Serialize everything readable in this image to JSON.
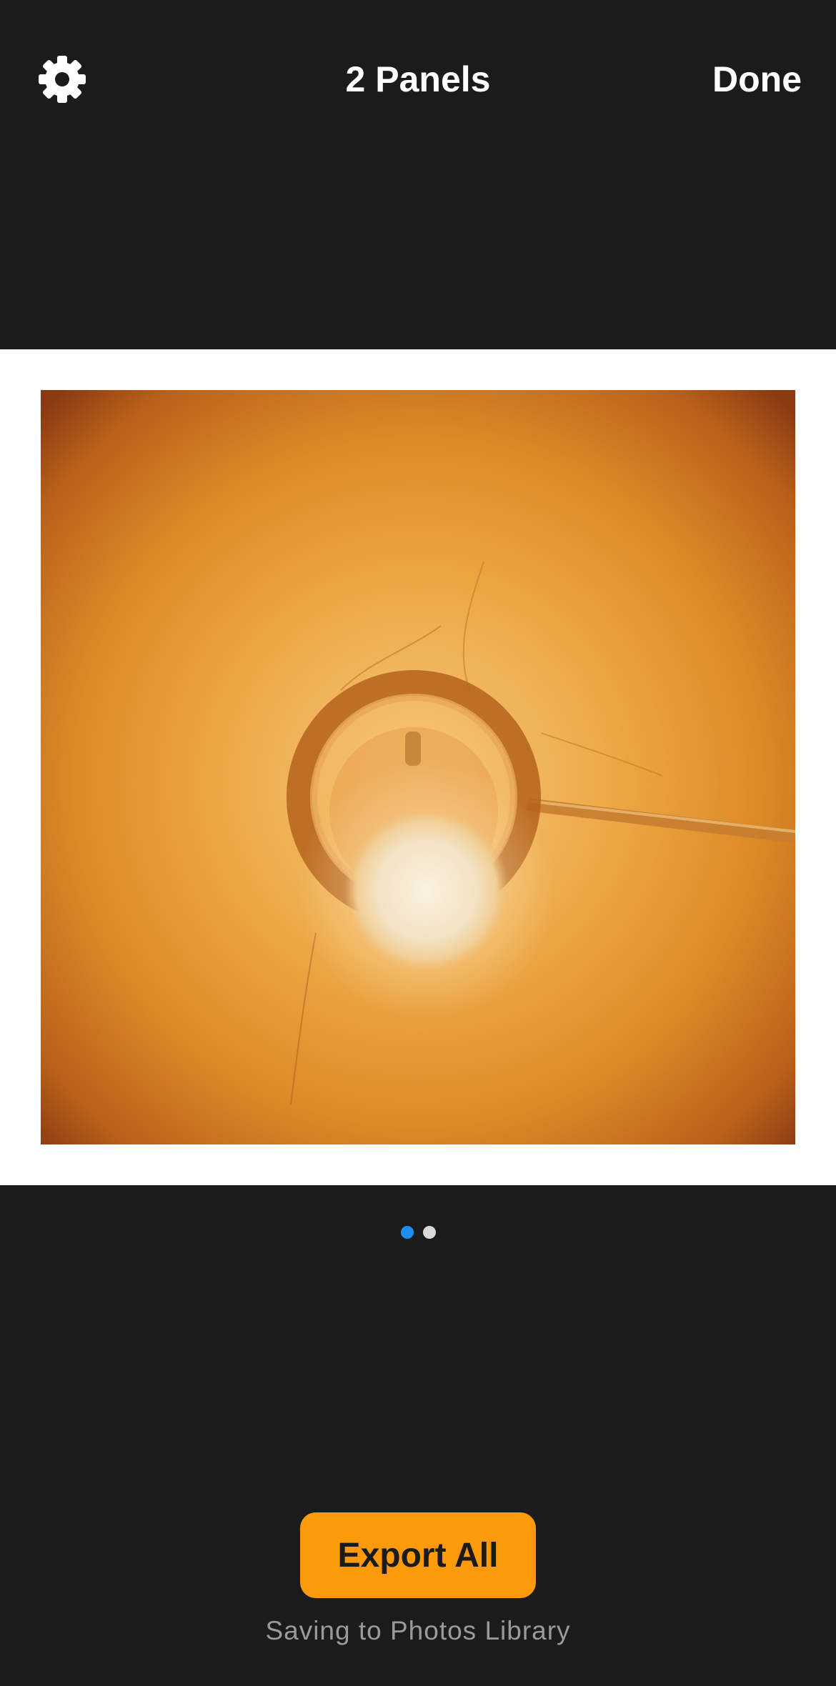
{
  "header": {
    "title": "2 Panels",
    "done_label": "Done",
    "settings_icon": "gear-icon"
  },
  "preview": {
    "panel_count": 2,
    "current_panel": 1,
    "colors": {
      "frame": "#ffffff",
      "photo_tone": "#d07a1e"
    }
  },
  "pager": {
    "active_color": "#1e8ef2",
    "inactive_color": "#d9d9d9"
  },
  "footer": {
    "export_label": "Export All",
    "export_color": "#fb9a0a",
    "save_note": "Saving to Photos Library"
  }
}
